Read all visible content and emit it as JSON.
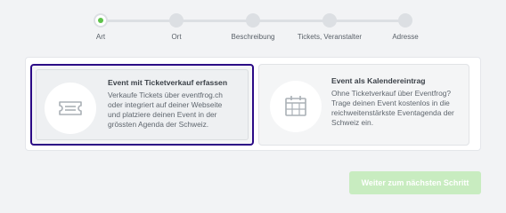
{
  "steps": [
    {
      "label": "Art",
      "state": "active"
    },
    {
      "label": "Ort",
      "state": "inactive"
    },
    {
      "label": "Beschreibung",
      "state": "inactive"
    },
    {
      "label": "Tickets, Veranstalter",
      "state": "inactive"
    },
    {
      "label": "Adresse",
      "state": "inactive"
    }
  ],
  "options": [
    {
      "title": "Event mit Ticketverkauf erfassen",
      "icon": "ticket-icon",
      "lines": [
        "Verkaufe Tickets über eventfrog.ch",
        "oder integriert auf deiner Webseite",
        "und platziere deinen Event in der",
        "grössten Agenda der Schweiz."
      ],
      "selected": true
    },
    {
      "title": "Event als Kalendereintrag",
      "icon": "calendar-icon",
      "lines": [
        "Ohne Ticketverkauf über Eventfrog?",
        "Trage deinen Event kostenlos in die",
        "reichweitenstärkste Eventagenda der",
        "Schweiz ein."
      ],
      "selected": false
    }
  ],
  "next_button_label": "Weiter zum nächsten Schritt",
  "colors": {
    "active_step": "#5ec24a",
    "selected_border": "#2b0a86",
    "next_button_disabled": "#c8ecc0"
  }
}
